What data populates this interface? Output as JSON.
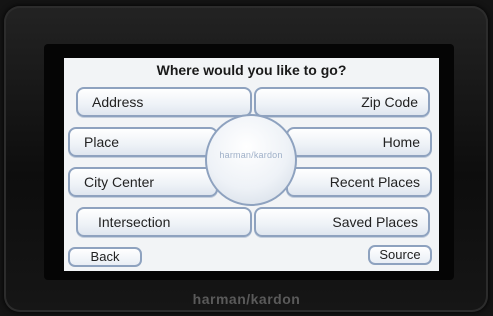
{
  "screen": {
    "title": "Where would you like to go?",
    "menu_left": [
      "Address",
      "Place",
      "City Center",
      "Intersection"
    ],
    "menu_right": [
      "Zip Code",
      "Home",
      "Recent Places",
      "Saved Places"
    ],
    "hub_logo": "harman/kardon",
    "back_label": "Back",
    "source_label": "Source"
  },
  "device": {
    "brand": "harman/kardon"
  },
  "colors": {
    "button_border": "#8ea2bf",
    "screen_bg": "#f2f4f6",
    "bezel": "#141414"
  }
}
